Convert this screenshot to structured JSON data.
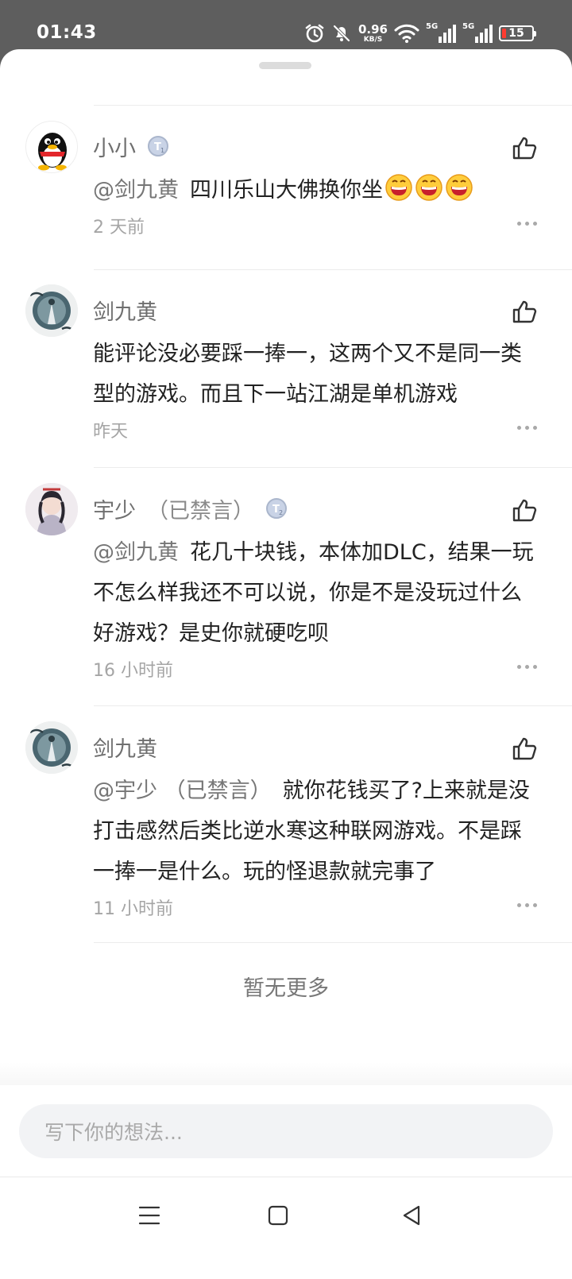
{
  "status_bar": {
    "time": "01:43",
    "net_speed_value": "0.96",
    "net_speed_unit": "KB/S",
    "signal1_tag": "5G",
    "signal2_tag": "5G",
    "battery": "15",
    "battery_color": "#ff3b30"
  },
  "comments": [
    {
      "name": "小小",
      "level_badge": "T1",
      "avatar": "qq-penguin-avatar",
      "mention": "@剑九黄",
      "text": "四川乐山大佛换你坐",
      "emojis": [
        "grinning-face",
        "grinning-face",
        "grinning-face"
      ],
      "time": "2 天前"
    },
    {
      "name": "剑九黄",
      "avatar": "ink-painting-avatar",
      "text": "能评论没必要踩一捧一，这两个又不是同一类型的游戏。而且下一站江湖是单机游戏",
      "time": "昨天"
    },
    {
      "name": "宇少",
      "name_tag": "（已禁言）",
      "level_badge": "T2",
      "avatar": "character-portrait-avatar",
      "mention": "@剑九黄",
      "text": "花几十块钱，本体加DLC，结果一玩不怎么样我还不可以说，你是不是没玩过什么好游戏？是史你就硬吃呗",
      "time": "16 小时前"
    },
    {
      "name": "剑九黄",
      "avatar": "ink-painting-avatar",
      "mention": "@宇少 （已禁言）",
      "text": "就你花钱买了?上来就是没打击感然后类比逆水寒这种联网游戏。不是踩一捧一是什么。玩的怪退款就完事了",
      "time": "11 小时前"
    }
  ],
  "footer": {
    "no_more": "暂无更多",
    "input_placeholder": "写下你的想法..."
  },
  "icons": [
    "alarm-icon",
    "bell-off-icon",
    "wifi-icon",
    "thumbs-up-icon",
    "more-icon",
    "menu-icon",
    "home-square-icon",
    "back-triangle-icon"
  ]
}
